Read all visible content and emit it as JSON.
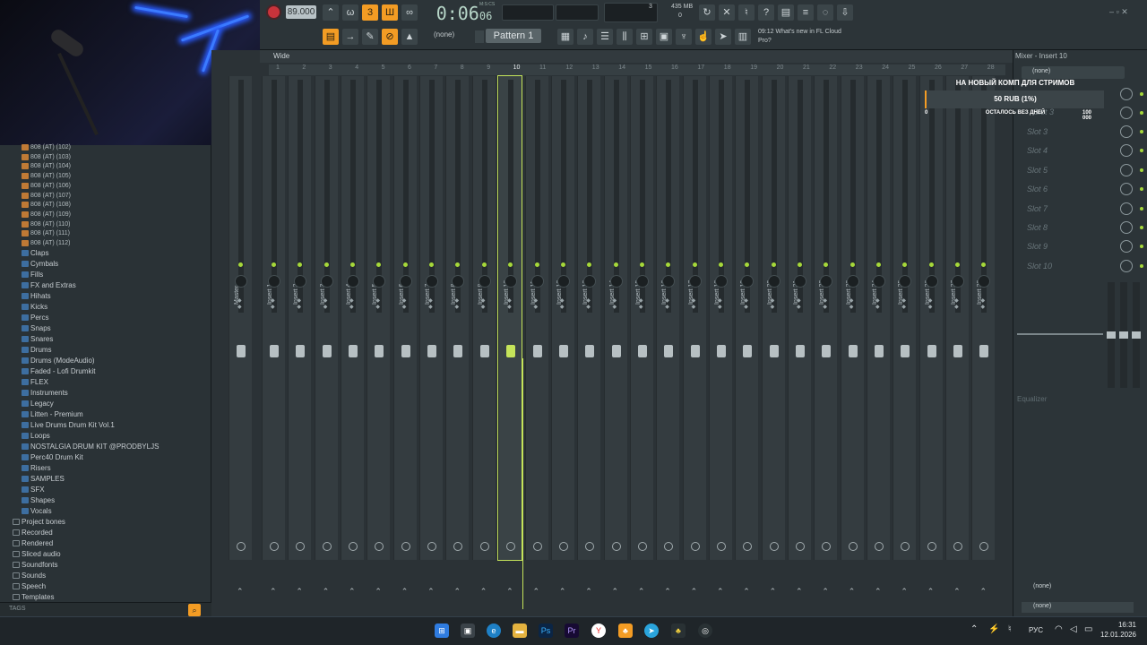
{
  "toolbar": {
    "tempo": "89.000",
    "time_main": "0:06",
    "time_sub": "06",
    "time_unit": "M:S:CS",
    "cpu_value": "3",
    "ram_value": "435 MB",
    "ram_sub": "0",
    "pattern_selector_value": "(none)",
    "pattern_name": "Pattern 1",
    "news_time": "09:12",
    "news_text": "What's new in FL Cloud Pro?",
    "accent_color": "#f39c24"
  },
  "mixer": {
    "view_label": "Wide",
    "ruler_ticks": [
      "1",
      "2",
      "3",
      "4",
      "5",
      "6",
      "7",
      "8",
      "9",
      "10",
      "11",
      "12",
      "13",
      "14",
      "15",
      "16",
      "17",
      "18",
      "19",
      "20",
      "21",
      "22",
      "23",
      "24",
      "25",
      "26",
      "27",
      "28"
    ],
    "strips": [
      "Master",
      "Insert 1",
      "Insert 2",
      "Insert 3",
      "Insert 4",
      "Insert 5",
      "Insert 6",
      "Insert 7",
      "Insert 8",
      "Insert 9",
      "Insert 10",
      "Insert 11",
      "Insert 12",
      "Insert 13",
      "Insert 14",
      "Insert 15",
      "Insert 16",
      "Insert 17",
      "Insert 18",
      "Insert 19",
      "Insert 20",
      "Insert 21",
      "Insert 22",
      "Insert 23",
      "Insert 24",
      "Insert 25",
      "Insert 26",
      "Insert 27",
      "Insert 28"
    ],
    "selected_strip": "Insert 10",
    "highlight_color": "#c5e45a"
  },
  "right_panel": {
    "title": "Mixer - Insert 10",
    "input_value": "(none)",
    "slots": [
      "Slot 3",
      "Slot 4",
      "Slot 5",
      "Slot 6",
      "Slot 7",
      "Slot 8",
      "Slot 9",
      "Slot 10"
    ],
    "slot_partial": "Slot 3",
    "equalizer_label": "Equalizer",
    "output_top": "(none)",
    "output_bottom": "(none)"
  },
  "donation": {
    "title": "НА НОВЫЙ КОМП ДЛЯ СТРИМОВ",
    "amount": "50 RUB (1%)",
    "remaining": "ОСТАЛОСЬ ВЕЗ ДНЕЙ",
    "min": "0",
    "max": "100 000",
    "progress_percent": 1
  },
  "browser": {
    "samples": [
      "808 (AT) (102)",
      "808 (AT) (103)",
      "808 (AT) (104)",
      "808 (AT) (105)",
      "808 (AT) (106)",
      "808 (AT) (107)",
      "808 (AT) (108)",
      "808 (AT) (109)",
      "808 (AT) (110)",
      "808 (AT) (111)",
      "808 (AT) (112)"
    ],
    "folders": [
      "Claps",
      "Cymbals",
      "Fills",
      "FX and Extras",
      "Hihats",
      "Kicks",
      "Percs",
      "Snaps",
      "Snares",
      "Drums",
      "Drums (ModeAudio)",
      "Faded - Lofi Drumkit",
      "FLEX",
      "Instruments",
      "Legacy",
      "Litten - Premium",
      "Live Drums Drum Kit Vol.1",
      "Loops",
      "NOSTALGIA DRUM KIT @PRODBYLJS",
      "Perc40 Drum Kit",
      "Risers",
      "SAMPLES",
      "SFX",
      "Shapes",
      "Vocals",
      "Project bones",
      "Recorded",
      "Rendered",
      "Sliced audio",
      "Soundfonts",
      "Sounds",
      "Speech",
      "Templates"
    ],
    "tags_label": "TAGS"
  },
  "taskbar": {
    "lang": "РУС",
    "time": "16:31",
    "date": "12.01.2026"
  }
}
